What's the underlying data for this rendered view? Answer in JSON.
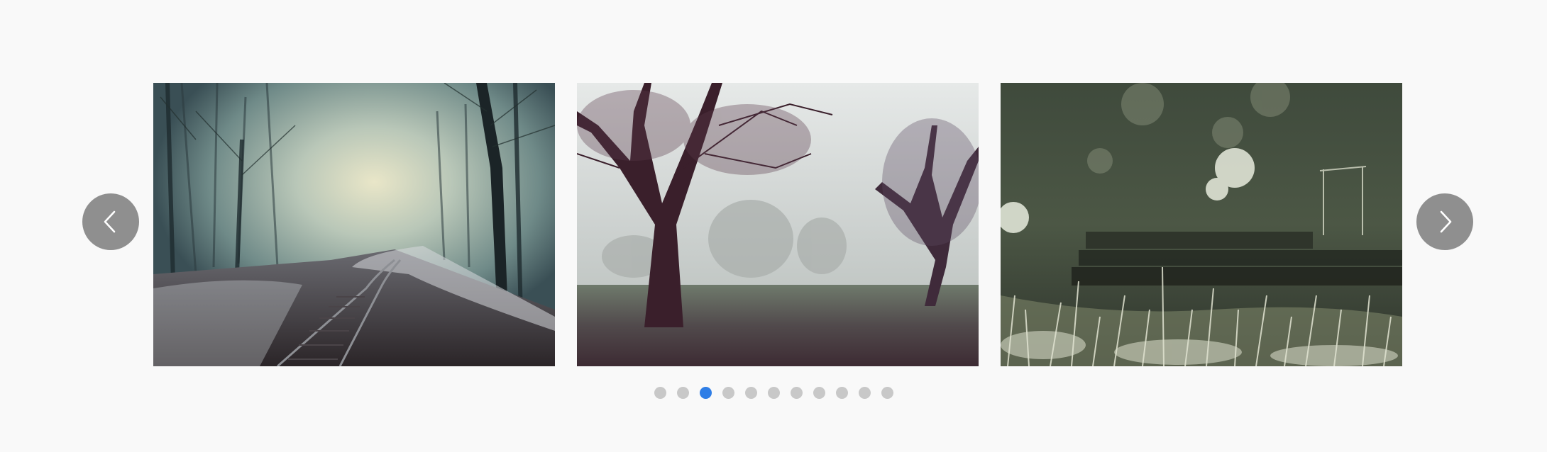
{
  "carousel": {
    "slides": [
      {
        "name": "foggy-forest-railway-photo",
        "alt": ""
      },
      {
        "name": "misty-park-trees-photo",
        "alt": ""
      },
      {
        "name": "blurred-grass-steps-photo",
        "alt": ""
      }
    ],
    "prev_icon": "chevron-left-icon",
    "next_icon": "chevron-right-icon",
    "page_count": 11,
    "active_page": 3,
    "colors": {
      "background": "#f9f9f9",
      "nav_button": "#8f8f8f",
      "dot_inactive": "#c8c8c8",
      "dot_active": "#2f7ee6"
    }
  }
}
